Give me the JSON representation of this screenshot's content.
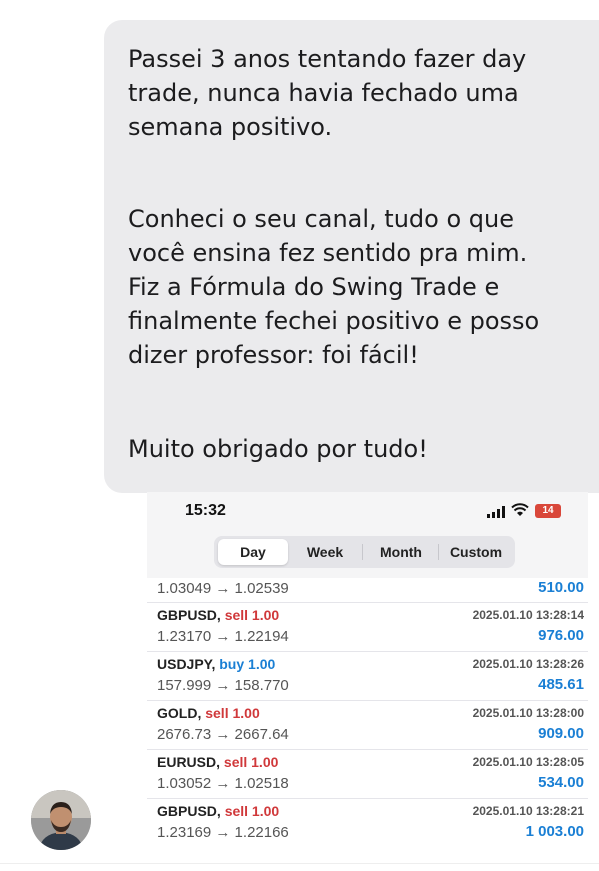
{
  "message": {
    "paragraphs": [
      "Passei 3 anos tentando fazer day\ntrade, nunca havia fechado uma\nsemana positivo.",
      "Conheci o seu canal, tudo o que\nvocê ensina fez sentido pra mim.\nFiz a Fórmula do Swing Trade e\nfinalmente fechei positivo e posso\ndizer professor: foi fácil!",
      "Muito obrigado por tudo!"
    ]
  },
  "phone": {
    "time": "15:32",
    "battery": "14",
    "tabs": [
      "Day",
      "Week",
      "Month",
      "Custom"
    ],
    "active_tab": "Day",
    "partial_row": {
      "prices": "1.03049 → 1.02539",
      "profit": "510.00"
    },
    "trades": [
      {
        "symbol": "GBPUSD,",
        "side": "sell 1.00",
        "side_type": "sell",
        "timestamp": "2025.01.10 13:28:14",
        "prices": "1.23170 → 1.22194",
        "profit": "976.00"
      },
      {
        "symbol": "USDJPY,",
        "side": "buy 1.00",
        "side_type": "buy",
        "timestamp": "2025.01.10 13:28:26",
        "prices": "157.999 → 158.770",
        "profit": "485.61"
      },
      {
        "symbol": "GOLD,",
        "side": "sell 1.00",
        "side_type": "sell",
        "timestamp": "2025.01.10 13:28:00",
        "prices": "2676.73 → 2667.64",
        "profit": "909.00"
      },
      {
        "symbol": "EURUSD,",
        "side": "sell 1.00",
        "side_type": "sell",
        "timestamp": "2025.01.10 13:28:05",
        "prices": "1.03052 → 1.02518",
        "profit": "534.00"
      },
      {
        "symbol": "GBPUSD,",
        "side": "sell 1.00",
        "side_type": "sell",
        "timestamp": "2025.01.10 13:28:21",
        "prices": "1.23169 → 1.22166",
        "profit": "1 003.00"
      }
    ]
  },
  "colors": {
    "sell": "#d0383a",
    "buy": "#1a7fd4",
    "profit": "#1a7fd4",
    "bubble": "#ebebed"
  }
}
